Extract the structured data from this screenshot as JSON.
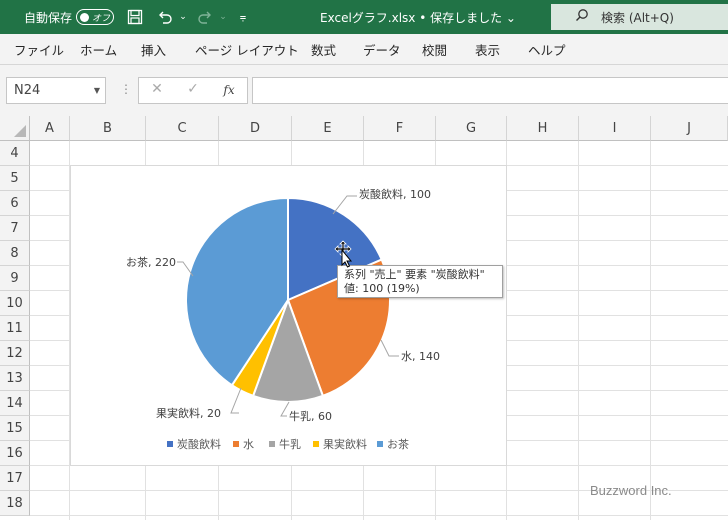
{
  "titlebar": {
    "autosave_label": "自動保存",
    "autosave_state": "オフ",
    "doc_title": "Excelグラフ.xlsx • 保存しました ⌄",
    "search_placeholder": "検索 (Alt+Q)",
    "icons": [
      "save-icon",
      "undo-icon",
      "redo-icon",
      "customize-icon",
      "search-icon"
    ]
  },
  "ribbon": {
    "tabs": [
      "ファイル",
      "ホーム",
      "挿入",
      "ページ レイアウト",
      "数式",
      "データ",
      "校閲",
      "表示",
      "ヘルプ"
    ]
  },
  "formula_bar": {
    "name_box": "N24",
    "formula": ""
  },
  "grid": {
    "columns": [
      "A",
      "B",
      "C",
      "D",
      "E",
      "F",
      "G",
      "H",
      "I",
      "J"
    ],
    "rows": [
      "4",
      "5",
      "6",
      "7",
      "8",
      "9",
      "10",
      "11",
      "12",
      "13",
      "14",
      "15",
      "16",
      "17",
      "18"
    ]
  },
  "chart_data": {
    "type": "pie",
    "categories": [
      "炭酸飲料",
      "水",
      "牛乳",
      "果実飲料",
      "お茶"
    ],
    "values": [
      100,
      140,
      60,
      20,
      220
    ],
    "data_labels": [
      "炭酸飲料, 100",
      "水, 140",
      "牛乳, 60",
      "果実飲料, 20",
      "お茶, 220"
    ],
    "colors": [
      "#4472c4",
      "#ed7d31",
      "#a5a5a5",
      "#ffc000",
      "#5b9bd5"
    ],
    "legend_position": "bottom"
  },
  "tooltip": {
    "line1": "系列 \"売上\" 要素 \"炭酸飲料\"",
    "line2": "値: 100 (19%)"
  },
  "watermark": "Buzzword Inc."
}
